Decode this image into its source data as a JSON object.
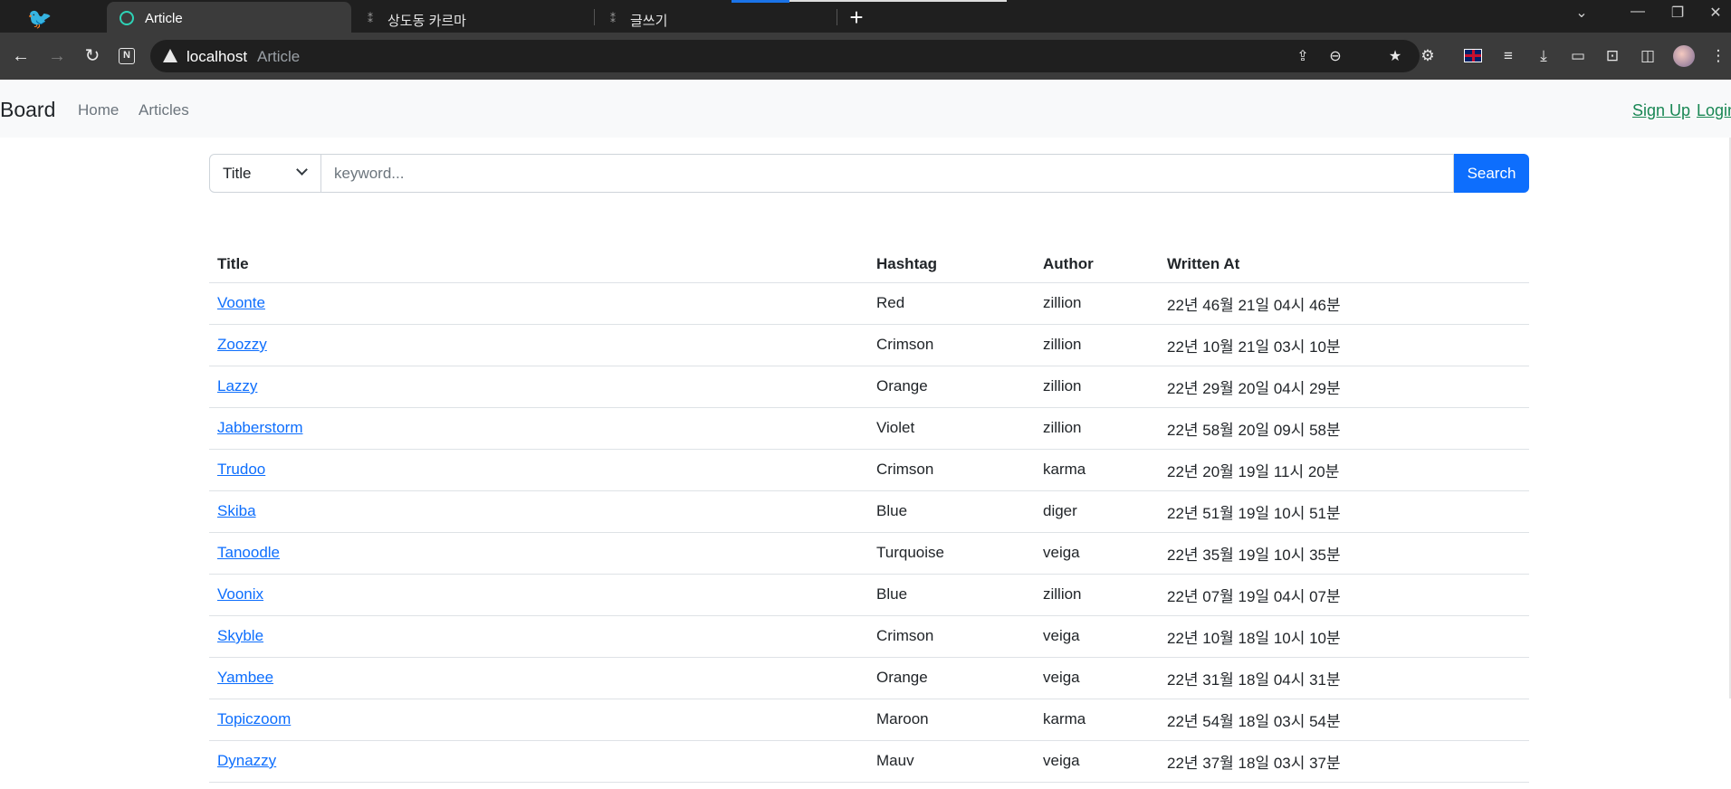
{
  "browser": {
    "tabs": [
      {
        "title": "Article",
        "active": true
      },
      {
        "title": "상도동 카르마",
        "active": false
      },
      {
        "title": "글쓰기",
        "active": false
      }
    ],
    "new_tab_icon": "plus-icon",
    "address": {
      "host": "localhost",
      "page_title": "Article"
    },
    "accent_color": "#1a73e8"
  },
  "navbar": {
    "brand": "Board",
    "links": [
      "Home",
      "Articles"
    ],
    "sign_up": "Sign Up",
    "login": "Login"
  },
  "search": {
    "selected_type": "Title",
    "placeholder": "keyword...",
    "button_label": "Search"
  },
  "table": {
    "headers": [
      "Title",
      "Hashtag",
      "Author",
      "Written At"
    ],
    "rows": [
      {
        "title": "Voonte",
        "hashtag": "Red",
        "author": "zillion",
        "written_at": "22년 46월 21일 04시 46분"
      },
      {
        "title": "Zoozzy",
        "hashtag": "Crimson",
        "author": "zillion",
        "written_at": "22년 10월 21일 03시 10분"
      },
      {
        "title": "Lazzy",
        "hashtag": "Orange",
        "author": "zillion",
        "written_at": "22년 29월 20일 04시 29분"
      },
      {
        "title": "Jabberstorm",
        "hashtag": "Violet",
        "author": "zillion",
        "written_at": "22년 58월 20일 09시 58분"
      },
      {
        "title": "Trudoo",
        "hashtag": "Crimson",
        "author": "karma",
        "written_at": "22년 20월 19일 11시 20분"
      },
      {
        "title": "Skiba",
        "hashtag": "Blue",
        "author": "diger",
        "written_at": "22년 51월 19일 10시 51분"
      },
      {
        "title": "Tanoodle",
        "hashtag": "Turquoise",
        "author": "veiga",
        "written_at": "22년 35월 19일 10시 35분"
      },
      {
        "title": "Voonix",
        "hashtag": "Blue",
        "author": "zillion",
        "written_at": "22년 07월 19일 04시 07분"
      },
      {
        "title": "Skyble",
        "hashtag": "Crimson",
        "author": "veiga",
        "written_at": "22년 10월 18일 10시 10분"
      },
      {
        "title": "Yambee",
        "hashtag": "Orange",
        "author": "veiga",
        "written_at": "22년 31월 18일 04시 31분"
      },
      {
        "title": "Topiczoom",
        "hashtag": "Maroon",
        "author": "karma",
        "written_at": "22년 54월 18일 03시 54분"
      },
      {
        "title": "Dynazzy",
        "hashtag": "Mauv",
        "author": "veiga",
        "written_at": "22년 37월 18일 03시 37분"
      }
    ]
  },
  "colors": {
    "link": "#0d6efd",
    "search_button": "#0d6efd",
    "auth_link": "#198754"
  }
}
